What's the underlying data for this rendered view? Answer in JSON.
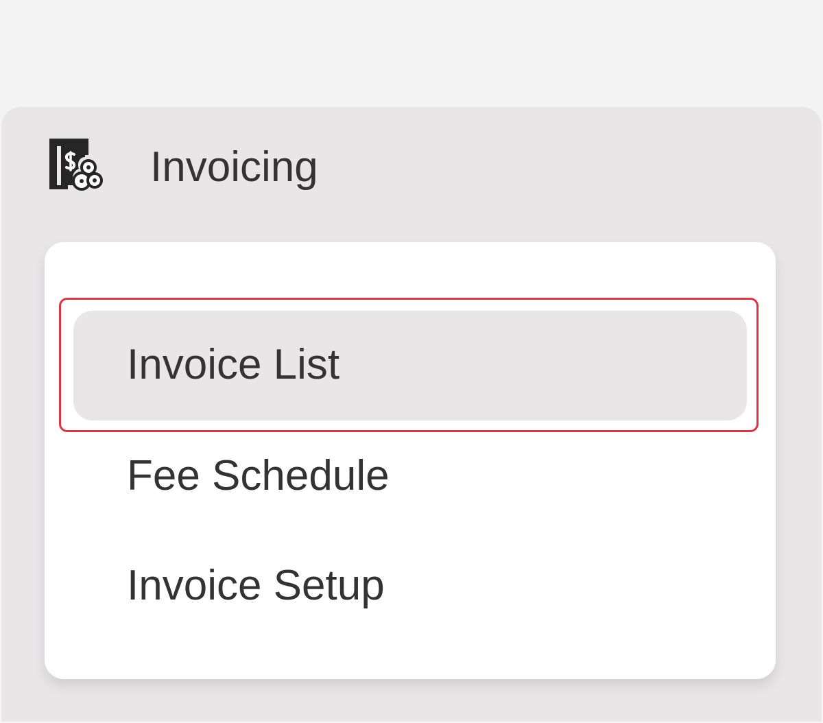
{
  "section": {
    "title": "Invoicing",
    "icon": "invoice-settings-icon"
  },
  "menu": {
    "items": [
      {
        "label": "Invoice List",
        "active": true
      },
      {
        "label": "Fee Schedule",
        "active": false
      },
      {
        "label": "Invoice Setup",
        "active": false
      }
    ]
  },
  "colors": {
    "background": "#f4f4f4",
    "panel": "#e8e6e7",
    "card": "#ffffff",
    "text": "#333333",
    "highlight": "#d93645"
  }
}
